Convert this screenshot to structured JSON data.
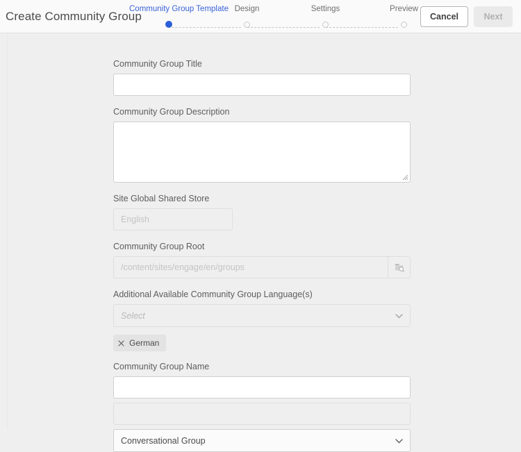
{
  "header": {
    "title": "Create Community Group",
    "steps": [
      {
        "label": "Community Group Template",
        "active": true
      },
      {
        "label": "Design",
        "active": false
      },
      {
        "label": "Settings",
        "active": false
      },
      {
        "label": "Preview",
        "active": false
      }
    ],
    "cancel_label": "Cancel",
    "next_label": "Next",
    "active_step_color": "#2b5fd9"
  },
  "form": {
    "title_label": "Community Group Title",
    "title_value": "",
    "description_label": "Community Group Description",
    "description_value": "",
    "shared_store_label": "Site Global Shared Store",
    "shared_store_value": "English",
    "root_label": "Community Group Root",
    "root_value": "/content/sites/engage/en/groups",
    "languages_label": "Additional Available Community Group Language(s)",
    "languages_placeholder": "Select",
    "language_chips": [
      {
        "label": "German"
      }
    ],
    "name_label": "Community Group Name",
    "name_value": "",
    "extra_value": "",
    "group_type_value": "Conversational Group"
  }
}
